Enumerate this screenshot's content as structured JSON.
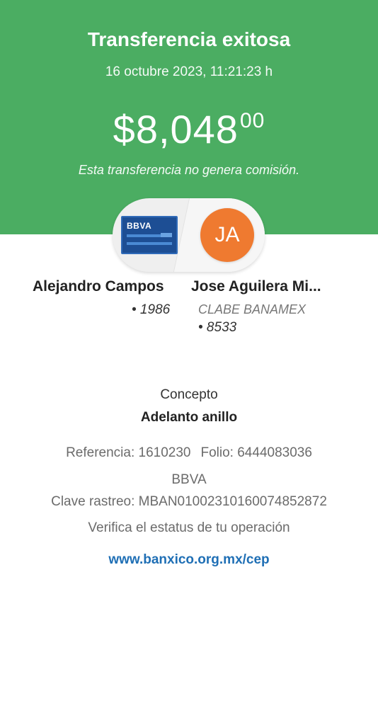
{
  "header": {
    "title": "Transferencia exitosa",
    "datetime": "16 octubre 2023, 11:21:23 h",
    "amount_main": "$8,048",
    "amount_cents": "00",
    "no_fee_text": "Esta transferencia no genera comisión.",
    "background_color": "#4bad62"
  },
  "transfer_visual": {
    "card_brand": "BBVA",
    "card_icon": "bank-card-icon",
    "avatar_initials": "JA",
    "avatar_color": "#ef7a30"
  },
  "sender": {
    "name": "Alejandro Campos",
    "account": "• 1986"
  },
  "recipient": {
    "name": "Jose Aguilera Mi...",
    "bank": "CLABE BANAMEX",
    "account": "• 8533"
  },
  "details": {
    "concept_label": "Concepto",
    "concept_value": "Adelanto anillo",
    "reference": "Referencia: 1610230",
    "folio": "Folio: 6444083036",
    "bank": "BBVA",
    "tracking": "Clave rastreo: MBAN01002310160074852872",
    "verify_text": "Verifica el estatus de tu operación",
    "verify_link": "www.banxico.org.mx/cep",
    "link_color": "#1f6fb5"
  }
}
